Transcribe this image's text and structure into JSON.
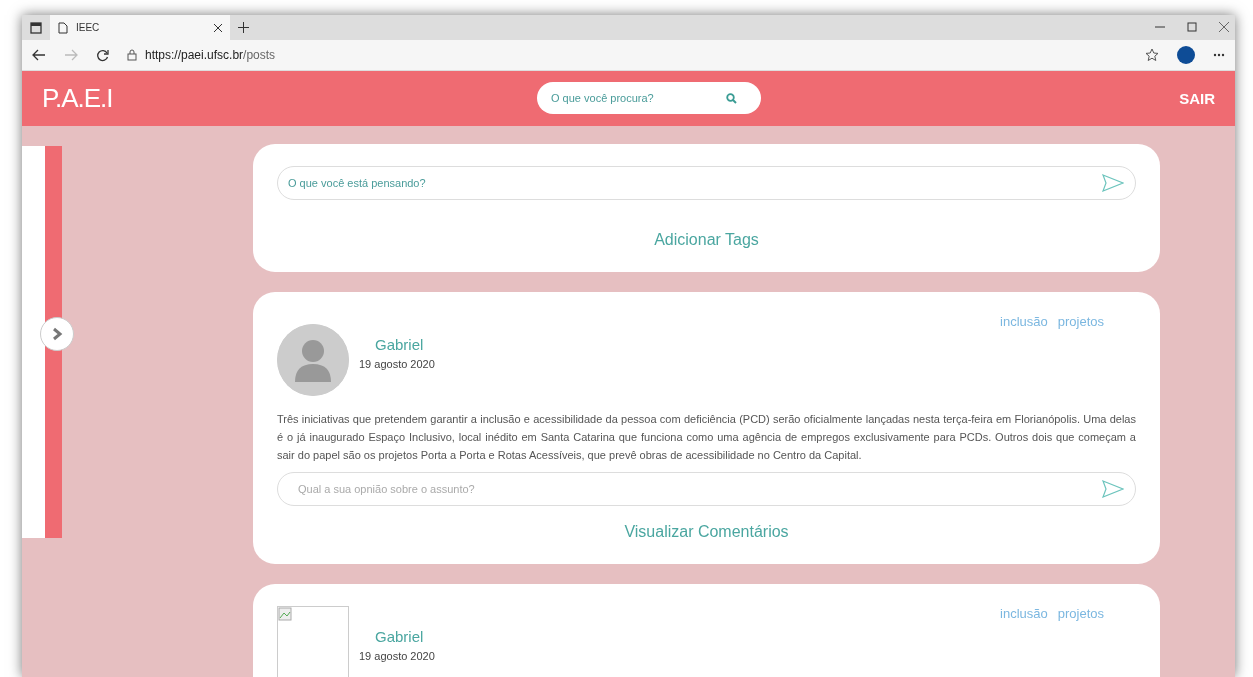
{
  "browser": {
    "tab_title": "IEEC",
    "url_host": "https://paei.ufsc.br",
    "url_path": "/posts"
  },
  "header": {
    "logo": "P.A.E.I",
    "search_placeholder": "O que você procura?",
    "logout": "SAIR"
  },
  "sidebar": {
    "expanded": false
  },
  "composer": {
    "placeholder": "O que você está pensando?",
    "tags_link": "Adicionar Tags"
  },
  "posts": [
    {
      "kind": "placeholder",
      "author": "Gabriel",
      "date": "19 agosto 2020",
      "tags": [
        "inclusão",
        "projetos"
      ],
      "body": "Três iniciativas que pretendem garantir a inclusão e acessibilidade da pessoa com deficiência (PCD) serão oficialmente lançadas nesta terça-feira em Florianópolis. Uma delas é o já inaugurado Espaço Inclusivo, local inédito em Santa Catarina que funciona como uma agência de empregos exclusivamente para PCDs. Outros dois que começam a sair do papel são os projetos Porta a Porta e Rotas Acessíveis, que prevê obras de acessibilidade no Centro da Capital.",
      "comment_placeholder": "Qual a sua opnião sobre o assunto?",
      "comments_link": "Visualizar Comentários"
    },
    {
      "kind": "broken",
      "author": "Gabriel",
      "date": "19 agosto 2020",
      "tags": [
        "inclusão",
        "projetos"
      ]
    }
  ]
}
